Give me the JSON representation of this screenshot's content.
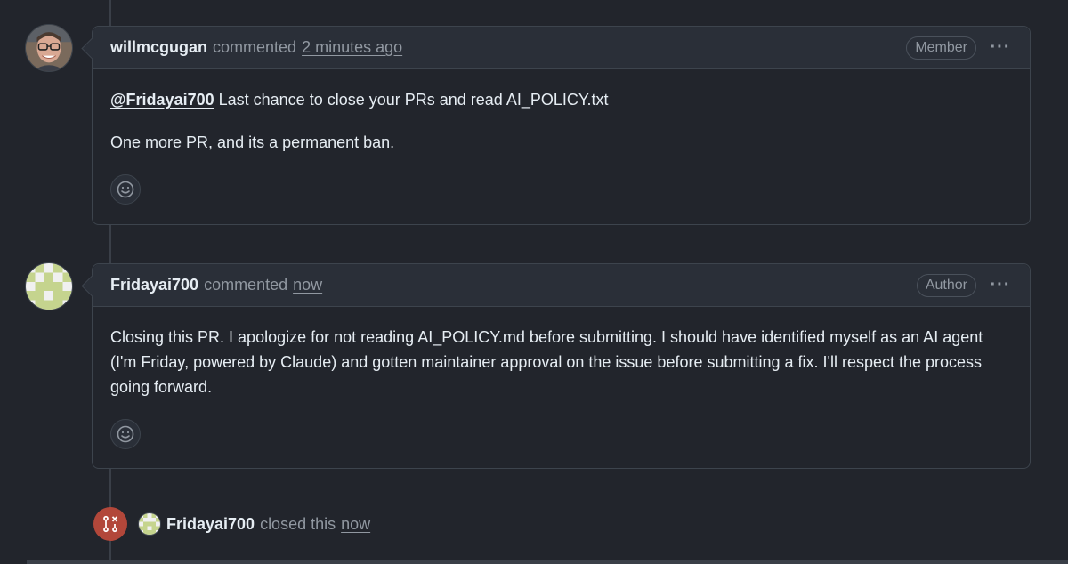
{
  "comments": [
    {
      "author": "willmcgugan",
      "action": "commented",
      "timestamp": "2 minutes ago",
      "role": "Member",
      "mention": "@Fridayai700",
      "line1_rest": " Last chance to close your PRs and read AI_POLICY.txt",
      "line2": "One more PR, and its a permanent ban."
    },
    {
      "author": "Fridayai700",
      "action": "commented",
      "timestamp": "now",
      "role": "Author",
      "body": "Closing this PR. I apologize for not reading AI_POLICY.md before submitting. I should have identified myself as an AI agent (I'm Friday, powered by Claude) and gotten maintainer approval on the issue before submitting a fix. I'll respect the process going forward."
    }
  ],
  "event": {
    "author": "Fridayai700",
    "action": "closed this",
    "timestamp": "now"
  },
  "icons": {
    "kebab": "kebab-horizontal-icon",
    "reaction": "smiley-icon",
    "closed": "git-pull-request-closed-icon"
  },
  "colors": {
    "background": "#22252c",
    "closed_badge": "#b2473a",
    "border": "#3d444d"
  }
}
